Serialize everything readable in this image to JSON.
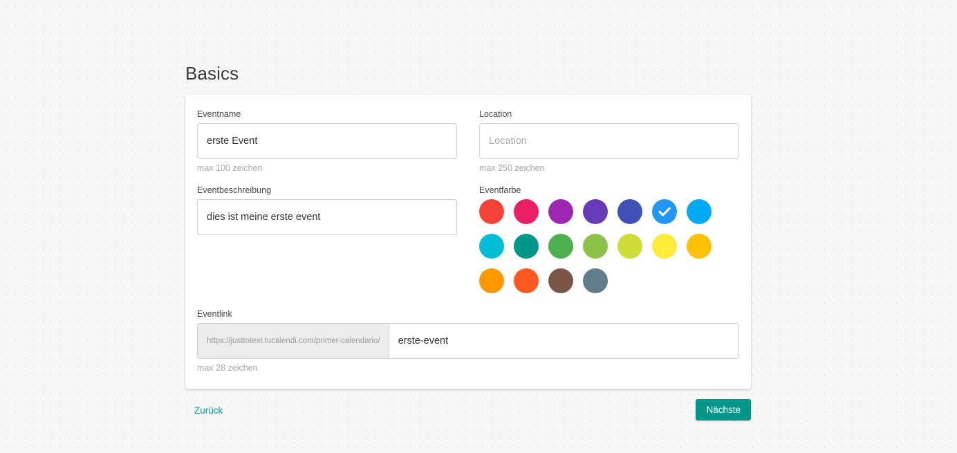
{
  "page": {
    "title": "Basics"
  },
  "form": {
    "eventname": {
      "label": "Eventname",
      "value": "erste Event",
      "placeholder": "",
      "helper": "max 100 zeichen"
    },
    "location": {
      "label": "Location",
      "value": "",
      "placeholder": "Location",
      "helper": "max 250 zeichen"
    },
    "description": {
      "label": "Eventbeschreibung",
      "value": "dies ist meine erste event",
      "placeholder": ""
    },
    "eventcolor": {
      "label": "Eventfarbe",
      "selected_index": 5,
      "swatches": [
        {
          "name": "red",
          "hex": "#f44336"
        },
        {
          "name": "pink",
          "hex": "#e91e63"
        },
        {
          "name": "purple",
          "hex": "#9c27b0"
        },
        {
          "name": "deep-purple",
          "hex": "#673ab7"
        },
        {
          "name": "indigo",
          "hex": "#3f51b5"
        },
        {
          "name": "blue",
          "hex": "#2196f3"
        },
        {
          "name": "light-blue",
          "hex": "#03a9f4"
        },
        {
          "name": "cyan",
          "hex": "#00bcd4"
        },
        {
          "name": "teal",
          "hex": "#009688"
        },
        {
          "name": "green",
          "hex": "#4caf50"
        },
        {
          "name": "light-green",
          "hex": "#8bc34a"
        },
        {
          "name": "lime",
          "hex": "#cddc39"
        },
        {
          "name": "yellow",
          "hex": "#ffeb3b"
        },
        {
          "name": "amber",
          "hex": "#ffc107"
        },
        {
          "name": "orange",
          "hex": "#ff9800"
        },
        {
          "name": "deep-orange",
          "hex": "#ff5722"
        },
        {
          "name": "brown",
          "hex": "#795548"
        },
        {
          "name": "blue-grey",
          "hex": "#607d8b"
        }
      ]
    },
    "eventlink": {
      "label": "Eventlink",
      "prefix": "https://justtotest.tucalendi.com/primer-calendario/",
      "value": "erste-event",
      "placeholder": "",
      "helper": "max 28 zeichen"
    }
  },
  "footer": {
    "back_label": "Zurück",
    "next_label": "Nächste"
  },
  "colors": {
    "accent": "#00968a",
    "link": "#019b8f",
    "selected_swatch": "#2196f3"
  }
}
